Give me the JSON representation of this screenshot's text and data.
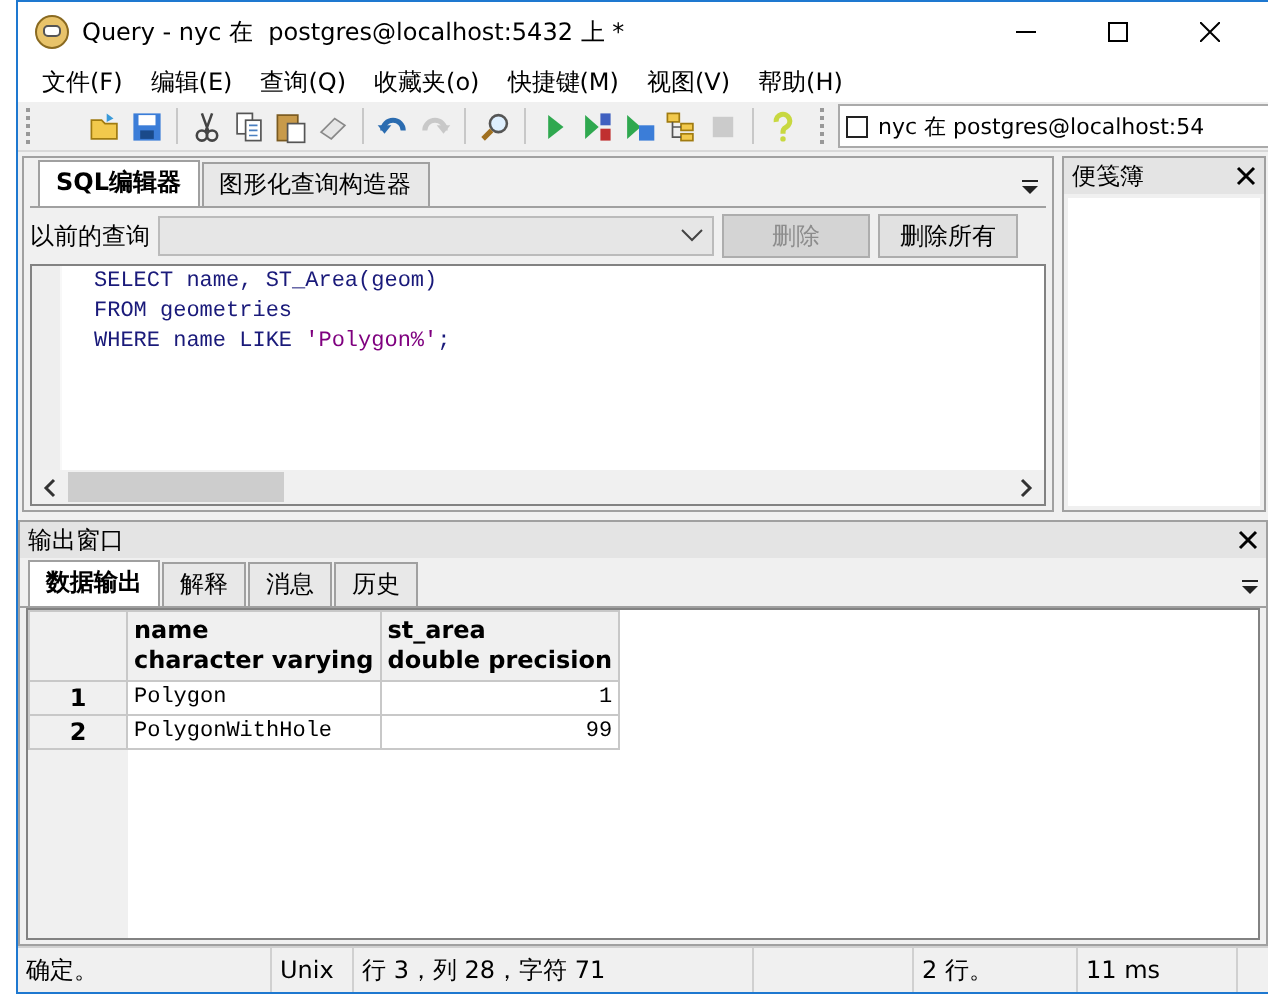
{
  "window": {
    "title": "Query - nyc 在  postgres@localhost:5432 上 *"
  },
  "menu": [
    "文件(F)",
    "编辑(E)",
    "查询(Q)",
    "收藏夹(o)",
    "快捷键(M)",
    "视图(V)",
    "帮助(H)"
  ],
  "toolbar": [
    {
      "kind": "open",
      "disabled": false
    },
    {
      "kind": "save",
      "disabled": false
    },
    {
      "kind": "sep"
    },
    {
      "kind": "cut",
      "disabled": false
    },
    {
      "kind": "copy",
      "disabled": false
    },
    {
      "kind": "paste",
      "disabled": false
    },
    {
      "kind": "eraser",
      "disabled": false
    },
    {
      "kind": "sep"
    },
    {
      "kind": "undo",
      "disabled": false
    },
    {
      "kind": "redo",
      "disabled": true
    },
    {
      "kind": "sep"
    },
    {
      "kind": "find",
      "disabled": false
    },
    {
      "kind": "sep"
    },
    {
      "kind": "run",
      "disabled": false
    },
    {
      "kind": "run-script",
      "disabled": false
    },
    {
      "kind": "run-file",
      "disabled": false
    },
    {
      "kind": "explain",
      "disabled": false
    },
    {
      "kind": "stop",
      "disabled": true
    },
    {
      "kind": "sep"
    },
    {
      "kind": "help",
      "disabled": false
    }
  ],
  "connection": "nyc 在  postgres@localhost:54",
  "editor": {
    "tabs": [
      {
        "label": "SQL编辑器",
        "selected": true
      },
      {
        "label": "图形化查询构造器",
        "selected": false
      }
    ],
    "previous_label": "以前的查询",
    "buttons": [
      {
        "label": "删除",
        "disabled": true
      },
      {
        "label": "删除所有",
        "disabled": false
      }
    ],
    "lines": [
      [
        {
          "kind": "code",
          "text": "SELECT name, ST_Area(geom)"
        }
      ],
      [
        {
          "kind": "code",
          "text": "FROM geometries"
        }
      ],
      [
        {
          "kind": "code",
          "text": "WHERE name LIKE "
        },
        {
          "kind": "string",
          "text": "'Polygon%'"
        },
        {
          "kind": "code",
          "text": ";"
        }
      ]
    ]
  },
  "scratch_pad": {
    "title": "便笺簿"
  },
  "output": {
    "title": "输出窗口",
    "tabs": [
      {
        "label": "数据输出",
        "selected": true
      },
      {
        "label": "解释",
        "selected": false
      },
      {
        "label": "消息",
        "selected": false
      },
      {
        "label": "历史",
        "selected": false
      }
    ],
    "columns": [
      {
        "name": "name",
        "type": "character varying",
        "kind": "text"
      },
      {
        "name": "st_area",
        "type": "double precision",
        "kind": "number"
      }
    ],
    "rows": [
      {
        "number": "1",
        "cells": [
          "Polygon",
          "1"
        ]
      },
      {
        "number": "2",
        "cells": [
          "PolygonWithHole",
          "99"
        ]
      }
    ]
  },
  "status_bar": [
    "确定。",
    "Unix",
    "行 3，列 28，字符 71",
    "2 行。",
    "11 ms"
  ]
}
